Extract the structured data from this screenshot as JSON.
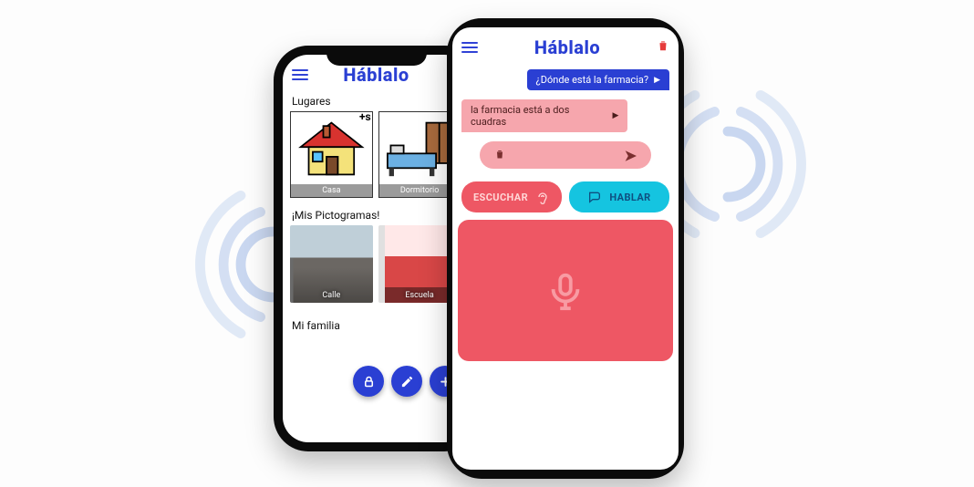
{
  "brand": "Háblalo",
  "left_phone": {
    "sections": {
      "places": {
        "title": "Lugares",
        "items": [
          {
            "label": "Casa",
            "badge": "+s"
          },
          {
            "label": "Dormitorio"
          }
        ]
      },
      "pictograms": {
        "title": "¡Mis Pictogramas!",
        "items": [
          {
            "label": "Calle"
          },
          {
            "label": "Escuela"
          }
        ]
      },
      "family": {
        "title": "Mi familia"
      }
    }
  },
  "right_phone": {
    "messages": {
      "sent": "¿Dónde está la farmacia?",
      "recv": "la farmacia está a dos cuadras"
    },
    "buttons": {
      "listen": "ESCUCHAR",
      "talk": "HABLAR"
    }
  }
}
